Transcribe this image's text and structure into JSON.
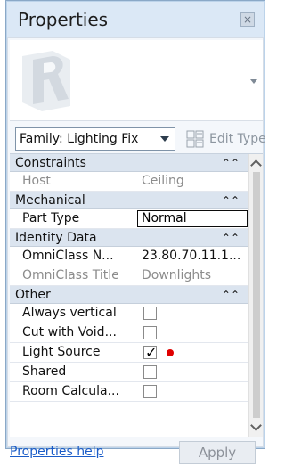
{
  "window": {
    "title": "Properties",
    "close_glyph": "×"
  },
  "type_selector": {
    "family_value": "Family: Lighting Fix",
    "edit_type_label": "Edit Type",
    "edit_type_icon": "edit-type-icon"
  },
  "grid": {
    "sections": [
      {
        "name": "Constraints",
        "rows": [
          {
            "label": "Host",
            "value": "Ceiling",
            "label_muted": true,
            "value_muted": true
          }
        ]
      },
      {
        "name": "Mechanical",
        "rows": [
          {
            "label": "Part Type",
            "value": "Normal",
            "editing": true
          }
        ]
      },
      {
        "name": "Identity Data",
        "rows": [
          {
            "label": "OmniClass N...",
            "value": "23.80.70.11.1..."
          },
          {
            "label": "OmniClass Title",
            "value": "Downlights",
            "label_muted": true,
            "value_muted": true
          }
        ]
      },
      {
        "name": "Other",
        "rows": [
          {
            "label": "Always vertical",
            "checked": false
          },
          {
            "label": "Cut with Void...",
            "checked": false
          },
          {
            "label": "Light Source",
            "checked": true,
            "marker_color": "#e00000"
          },
          {
            "label": "Shared",
            "checked": false
          },
          {
            "label": "Room Calcula...",
            "checked": false
          }
        ]
      }
    ],
    "collapse_glyph": "⌃⌃"
  },
  "footer": {
    "help_link": "Properties help",
    "apply_label": "Apply"
  },
  "colors": {
    "title_bg": "#dbe8f6",
    "section_bg": "#dbe4ef",
    "link": "#1a5cc8",
    "marker_red": "#e00000"
  }
}
